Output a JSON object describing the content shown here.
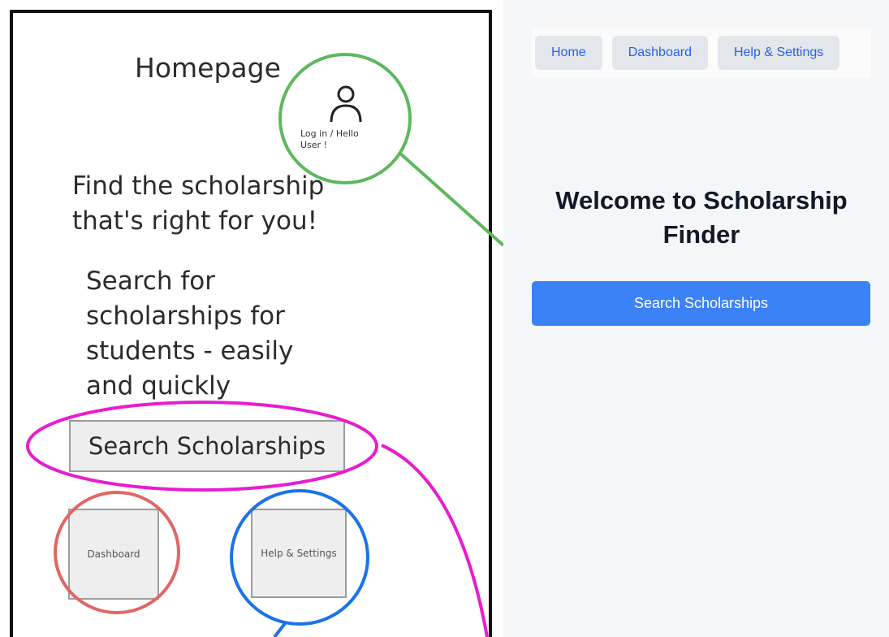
{
  "wireframe": {
    "title": "Homepage",
    "login_text": "Log in / Hello User !",
    "headline": "Find the scholarship that's right for you!",
    "subtext": "Search for scholarships for students - easily and quickly",
    "search_button": "Search Scholarships",
    "dashboard_box": "Dashboard",
    "help_box": "Help & Settings",
    "annotation_colors": {
      "login": "#5cb85c",
      "search": "#e81ccf",
      "dashboard": "#e06666",
      "help": "#1a73e8"
    }
  },
  "app": {
    "nav": {
      "home": "Home",
      "dashboard": "Dashboard",
      "help": "Help & Settings"
    },
    "welcome_title": "Welcome to Scholarship Finder",
    "search_button": "Search Scholarships",
    "colors": {
      "accent": "#3b82f6",
      "nav_text": "#2563eb",
      "background": "#f5f6f7"
    }
  }
}
